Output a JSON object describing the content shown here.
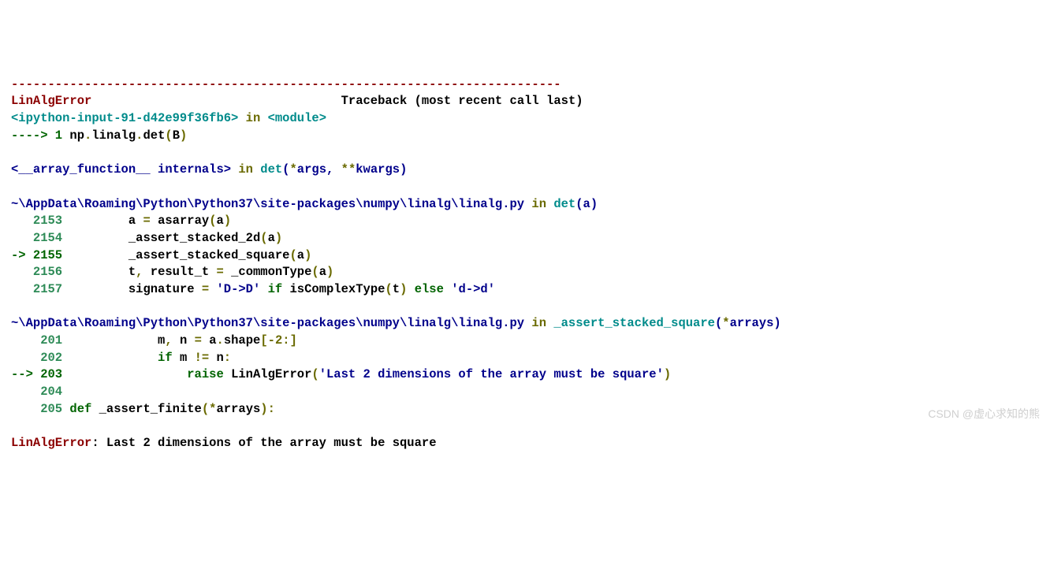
{
  "line0": "---------------------------------------------------------------------------",
  "exc": "LinAlgError",
  "pad0": "                                  ",
  "header_right": "Traceback (most recent call last)",
  "f0_loc": "<ipython-input-91-d42e99f36fb6>",
  "in_kw": " in ",
  "module_kw": "<module>",
  "arrow1": "----> 1 ",
  "c_np": "np",
  "dot": ".",
  "c_linalg": "linalg",
  "c_det": "det",
  "lp": "(",
  "rp": ")",
  "c_B": "B",
  "f1_loc": "<__array_function__ internals>",
  "det_fn": "det",
  "star": "*",
  "args": "args",
  "comma": ",",
  "sp": " ",
  "dstar": "**",
  "kwargs": "kwargs",
  "f2_loc": "~\\AppData\\Roaming\\Python\\Python37\\site-packages\\numpy\\linalg\\linalg.py",
  "a_arg": "a",
  "arrays_arg": "arrays",
  "ln2153": "   2153 ",
  "ln2154": "   2154 ",
  "ln2155": "-> 2155 ",
  "ln2156": "   2156 ",
  "ln2157": "   2157 ",
  "ind8": "        ",
  "a_var": "a",
  "eq": " = ",
  "asarray": "asarray",
  "a2d": "_assert_stacked_2d",
  "asq": "_assert_stacked_square",
  "t_var": "t",
  "result_t": " result_t",
  "commonType": "_commonType",
  "signature": "signature",
  "strDD": "'D->D'",
  "if_kw": "if",
  "isComplex": " isComplexType",
  "else_kw": "else",
  "strdd": "'d->d'",
  "ln201": "    201 ",
  "ln202": "    202 ",
  "ln203": "--> 203 ",
  "ln204": "    204",
  "ln205": "    205 ",
  "ind12": "            ",
  "ind16": "                ",
  "m_var": "m",
  "n_var": " n",
  "shape": "shape",
  "minus2": "-2",
  "colon": ":",
  "m2": " m ",
  "neq": "!=",
  "n2": " n",
  "raise_kw": "raise",
  "linAlg": " LinAlgError",
  "errstr": "'Last 2 dimensions of the array must be square'",
  "def_kw": "def",
  "afn": " _assert_finite",
  "final_msg": ": Last 2 dimensions of the array must be square",
  "watermark": "CSDN @虚心求知的熊"
}
